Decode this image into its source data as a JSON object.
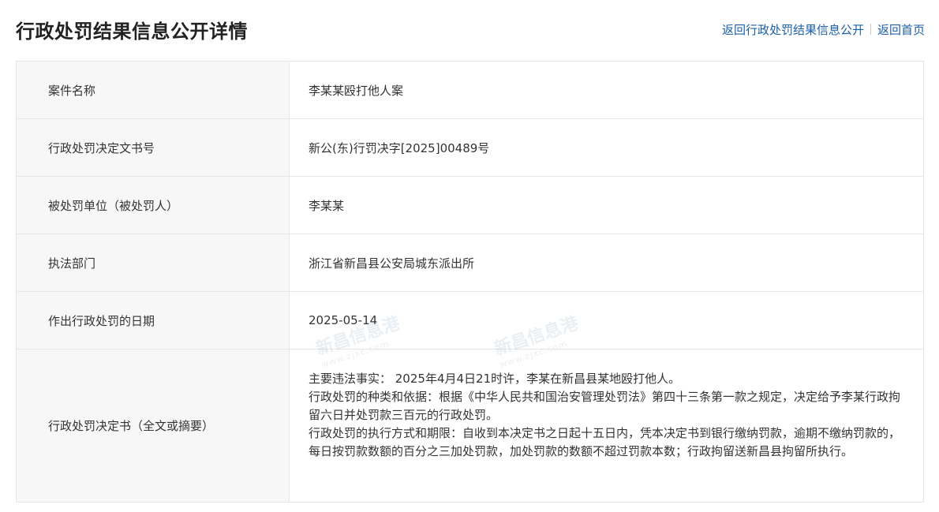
{
  "header": {
    "title": "行政处罚结果信息公开详情",
    "links": {
      "back_list": "返回行政处罚结果信息公开",
      "back_home": "返回首页"
    }
  },
  "rows": [
    {
      "label": "案件名称",
      "value": "李某某殴打他人案"
    },
    {
      "label": "行政处罚决定文书号",
      "value": "新公(东)行罚决字[2025]00489号"
    },
    {
      "label": "被处罚单位（被处罚人）",
      "value": "李某某"
    },
    {
      "label": "执法部门",
      "value": "浙江省新昌县公安局城东派出所"
    },
    {
      "label": "作出行政处罚的日期",
      "value": "2025-05-14"
    }
  ],
  "decision": {
    "label": "行政处罚决定书（全文或摘要）",
    "line1": "主要违法事实： 2025年4月4日21时许，李某在新昌县某地殴打他人。",
    "line2": "行政处罚的种类和依据：根据《中华人民共和国治安管理处罚法》第四十三条第一款之规定，决定给予李某行政拘留六日并处罚款三百元的行政处罚。",
    "line3": "行政处罚的执行方式和期限：自收到本决定书之日起十五日内，凭本决定书到银行缴纳罚款，逾期不缴纳罚款的，每日按罚款数额的百分之三加处罚款，加处罚款的数额不超过罚款本数；行政拘留送新昌县拘留所执行。"
  },
  "watermark": {
    "text": "新昌信息港",
    "sub": "www.zjxc.com"
  }
}
